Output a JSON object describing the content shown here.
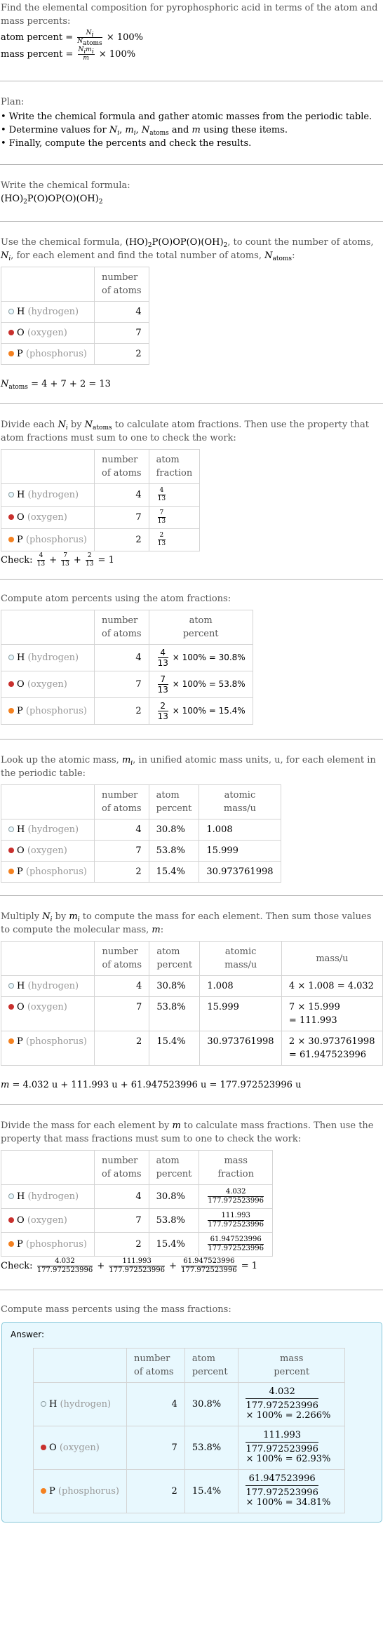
{
  "intro": {
    "text": "Find the elemental composition for pyrophosphoric acid in terms of the atom and mass percents:",
    "atom_percent_label": "atom percent =",
    "mass_percent_label": "mass percent =",
    "times_100": "× 100%"
  },
  "plan": {
    "title": "Plan:",
    "items": [
      "• Write the chemical formula and gather atomic masses from the periodic table.",
      "• Determine values for N_i, m_i, N_atoms and m using these items.",
      "• Finally, compute the percents and check the results."
    ]
  },
  "formula_step": {
    "text": "Write the chemical formula:",
    "formula": "(HO)2P(O)OP(O)(OH)2"
  },
  "elements": [
    {
      "symbol": "H",
      "name": "(hydrogen)",
      "color": "#e8f8fe",
      "border": "#8a9a9e",
      "count": "4",
      "atom_fraction_num": "4",
      "atom_fraction_den": "13",
      "atom_percent": "30.8%",
      "atomic_mass": "1.008",
      "mass_calc": "4 × 1.008 = 4.032",
      "mass_calc_line1": "4 × 1.008 = 4.032",
      "mass_calc_line2": "",
      "mass": "4.032",
      "mass_percent": "2.266%"
    },
    {
      "symbol": "O",
      "name": "(oxygen)",
      "color": "#c8302d",
      "border": "#c8302d",
      "count": "7",
      "atom_fraction_num": "7",
      "atom_fraction_den": "13",
      "atom_percent": "53.8%",
      "atomic_mass": "15.999",
      "mass_calc_line1": "7 × 15.999",
      "mass_calc_line2": "= 111.993",
      "mass": "111.993",
      "mass_percent": "62.93%"
    },
    {
      "symbol": "P",
      "name": "(phosphorus)",
      "color": "#f48120",
      "border": "#f48120",
      "count": "2",
      "atom_fraction_num": "2",
      "atom_fraction_den": "13",
      "atom_percent": "15.4%",
      "atomic_mass": "30.973761998",
      "mass_calc_line1": "2 × 30.973761998",
      "mass_calc_line2": "= 61.947523996",
      "mass": "61.947523996",
      "mass_percent": "34.81%"
    }
  ],
  "count_step": {
    "text_a": "Use the chemical formula, ",
    "text_b": ", to count the number of atoms, ",
    "text_c": ", for each element and find the total number of atoms, ",
    "text_d": ":",
    "n_atoms_equation": "= 4 + 7 + 2 = 13"
  },
  "headers": {
    "number_of_atoms_1": "number",
    "number_of_atoms_2": "of atoms",
    "atom_fraction_1": "atom",
    "atom_fraction_2": "fraction",
    "atom_percent_1": "atom",
    "atom_percent_2": "percent",
    "atomic_mass_1": "atomic",
    "atomic_mass_2": "mass/u",
    "mass": "mass/u",
    "mass_fraction_1": "mass",
    "mass_fraction_2": "fraction",
    "mass_percent_1": "mass",
    "mass_percent_2": "percent"
  },
  "fraction_step": {
    "text_a": "Divide each ",
    "text_b": " by ",
    "text_c": " to calculate atom fractions. Then use the property that atom fractions must sum to one to check the work:",
    "check_label": "Check:",
    "check_result": "= 1"
  },
  "atom_percent_step": {
    "text": "Compute atom percents using the atom fractions:",
    "times_100": "× 100% ="
  },
  "atomic_mass_step": {
    "text_a": "Look up the atomic mass, ",
    "text_b": ", in unified atomic mass units, u, for each element in the periodic table:"
  },
  "mass_step": {
    "text_a": "Multiply ",
    "text_b": " by ",
    "text_c": " to compute the mass for each element. Then sum those values to compute the molecular mass, ",
    "text_d": ":",
    "equation": "= 4.032 u + 111.993 u + 61.947523996 u = 177.972523996 u"
  },
  "mass_fraction_step": {
    "text_a": "Divide the mass for each element by ",
    "text_b": " to calculate mass fractions. Then use the property that mass fractions must sum to one to check the work:",
    "denominator": "177.972523996",
    "check_label": "Check:",
    "check_result": "= 1"
  },
  "mass_percent_step": {
    "text": "Compute mass percents using the mass fractions:",
    "answer_label": "Answer:",
    "times_100": "× 100% ="
  }
}
